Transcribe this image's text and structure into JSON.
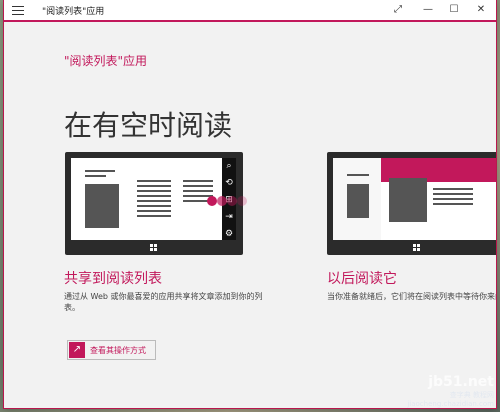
{
  "window": {
    "title": "\"阅读列表\"应用",
    "minimize": "—",
    "maximize": "☐",
    "close": "✕",
    "fullscreen": "⤢"
  },
  "app": {
    "title": "\"阅读列表\"应用",
    "hero": "在有空时阅读"
  },
  "section1": {
    "title": "共享到阅读列表",
    "desc": "通过从 Web 或你最喜爱的应用共享将文章添加到你的列表。"
  },
  "section2": {
    "title": "以后阅读它",
    "desc": "当你准备就绪后，它们将在阅读列表中等待你来阅"
  },
  "link": {
    "label": "查看其操作方式",
    "icon": "↗"
  },
  "watermark": {
    "main": "jb51.net",
    "site": "查字典 教程网",
    "url": "jiaocheng.chazidian.com"
  },
  "colors": {
    "accent": "#c2185b"
  },
  "icons": {
    "search": "⌕",
    "share": "⟲",
    "devices": "⇥",
    "settings": "⚙",
    "start": "⊞"
  }
}
